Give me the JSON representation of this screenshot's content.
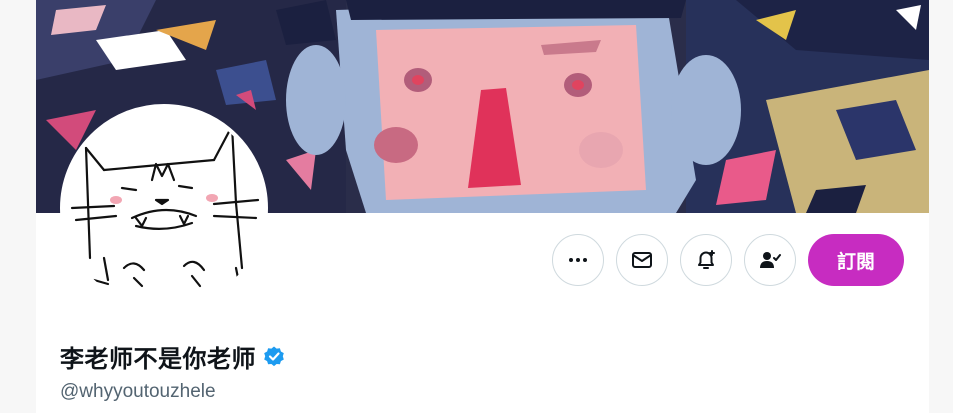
{
  "profile": {
    "display_name": "李老师不是你老师",
    "handle": "@whyyoutouzhele",
    "verified": true
  },
  "actions": {
    "more_icon": "more-horizontal-icon",
    "message_icon": "envelope-icon",
    "notify_icon": "bell-plus-icon",
    "following_icon": "person-check-icon",
    "subscribe_label": "訂閱"
  },
  "colors": {
    "subscribe_bg": "#c72cc1",
    "verified_badge": "#1d9bf0",
    "handle_text": "#536471",
    "name_text": "#0f1419"
  }
}
